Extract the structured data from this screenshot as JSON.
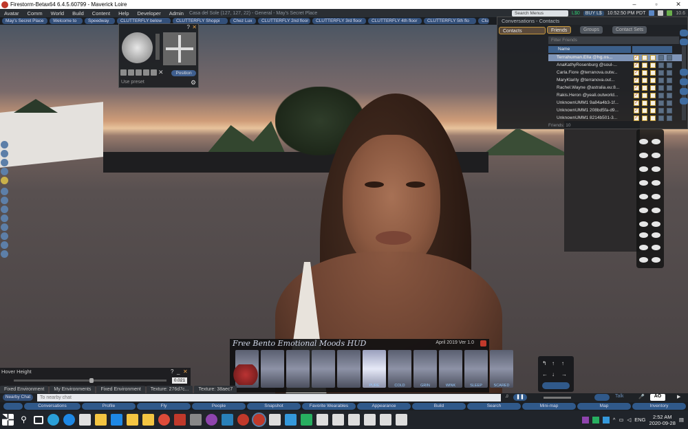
{
  "window": {
    "title": "Firestorm-Betax64 6.4.5.60799 - Maverick Loire",
    "minimize": "–",
    "maximize": "▫",
    "close": "✕"
  },
  "menubar": {
    "items": [
      "Avatar",
      "Comm",
      "World",
      "Build",
      "Content",
      "Help",
      "Developer",
      "Admin"
    ],
    "location": "Casa del Sole (127, 127, 22) - General - May's Secret Place",
    "search_placeholder": "Search Menus",
    "balance": "L$0",
    "buy": "BUY L$",
    "time": "10:52:50 PM PDT",
    "fps": "10.6"
  },
  "favorites": [
    "May's Secret Place",
    "Welcome to",
    "Speedway",
    "CLUTTERFLY below",
    "CLUTTERFLY Shoppi",
    "Chez Lux",
    "CLUTTERFLY 2nd floor",
    "CLUTTERFLY 3rd floor",
    "CLUTTERFLY 4th floor",
    "CLUTTERFLY 5th flo",
    "Clu"
  ],
  "camera": {
    "title_q": "?",
    "title_x": "✕",
    "preset_placeholder": "Use preset",
    "position_button": "Position",
    "icons": [
      "front-view",
      "side-view",
      "rear-view",
      "object-view",
      "mouselook-view"
    ]
  },
  "conversations": {
    "title": "Conversations - Contacts",
    "contacts_tab": "Contacts",
    "tabs": [
      "Friends",
      "Groups",
      "Contact Sets"
    ],
    "filter_placeholder": "Filter Friends",
    "column_name": "Name",
    "friends": [
      {
        "name": "Terrahuman.Ella @hg.os..."
      },
      {
        "name": "AnaKathyRosenburg @soul-..."
      },
      {
        "name": "Carla.Fiore @terranova.outw..."
      },
      {
        "name": "MaryKlarity @terranova.out..."
      },
      {
        "name": "Rachel.Wayne @astralia.eu:8..."
      },
      {
        "name": "Rakis.Heron @yeali.outworld..."
      },
      {
        "name": "UnknownUMM1 9a84a4b3-1f..."
      },
      {
        "name": "UnknownUMM1 208bd5fa-d9..."
      },
      {
        "name": "UnknownUMM1 8214b501-3..."
      }
    ],
    "friends_count": "Friends: 10"
  },
  "mood_hud": {
    "title": "Free Bento Emotional Moods HUD",
    "version": "April 2019 Ver 1.0",
    "faces": [
      "",
      "",
      "",
      "",
      "",
      "PURE",
      "COLD",
      "GRIN",
      "WINK",
      "SLEEP",
      "SCARED"
    ]
  },
  "hover_height": {
    "title": "Hover Height",
    "value": "0.021",
    "q": "?",
    "min": "_",
    "x": "✕"
  },
  "floater_tabs": [
    "Fixed Environment",
    "My Environments",
    "Fixed Environment",
    "Texture: 276d7c...",
    "Texture: 38aec7"
  ],
  "chat": {
    "nearby_button": "Nearby Chat",
    "placeholder": "To nearby chat",
    "talk": "Talk",
    "ao": "AO"
  },
  "bottom_toolbar": [
    "",
    "Conversations",
    "Profile",
    "Fly",
    "People",
    "Snapshot",
    "Favorite Wearables",
    "Appearance",
    "Build",
    "Search",
    "Mini-map",
    "Map",
    "Inventory"
  ],
  "taskbar": {
    "lang": "ENG",
    "time": "2:52 AM",
    "date": "2020-09-28"
  },
  "colors": {
    "accent": "#30598a",
    "checkbox_border": "#c39a2c",
    "balance_green": "#2ecc71"
  }
}
